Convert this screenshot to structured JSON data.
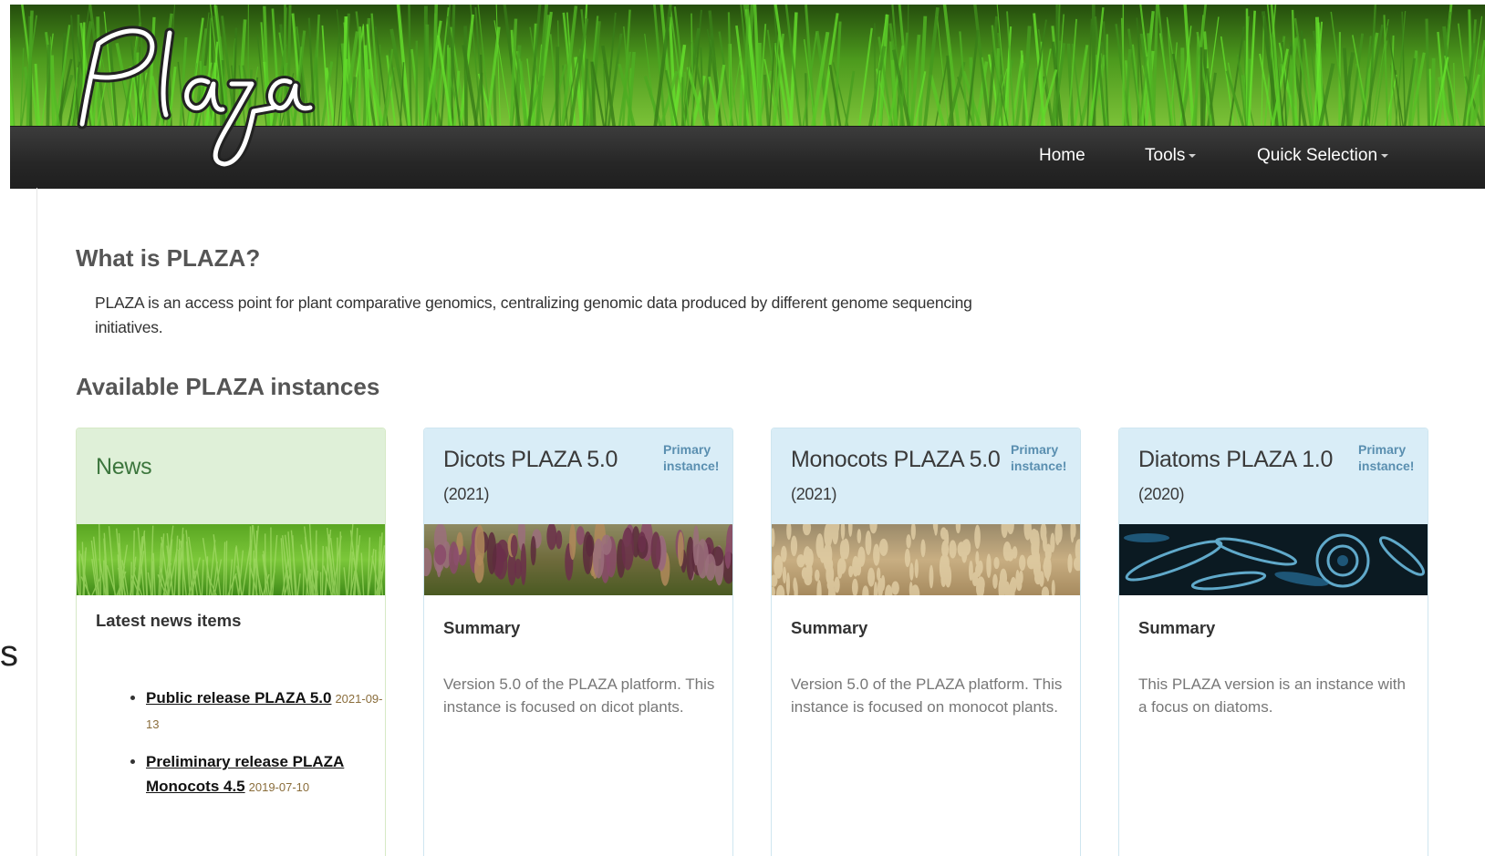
{
  "logo_text": "Plaza",
  "nav": {
    "home": "Home",
    "tools": "Tools",
    "quick_selection": "Quick Selection"
  },
  "stray_char": "s",
  "intro": {
    "heading": "What is PLAZA?",
    "text": "PLAZA is an access point for plant comparative genomics, centralizing genomic data produced by different genome sequencing initiatives."
  },
  "instances": {
    "heading": "Available PLAZA instances"
  },
  "news_card": {
    "title": "News",
    "subheading": "Latest news items",
    "items": [
      {
        "title": "Public release PLAZA 5.0",
        "date": "2021-09-13"
      },
      {
        "title": "Preliminary release PLAZA Monocots 4.5",
        "date": "2019-07-10"
      }
    ]
  },
  "cards": [
    {
      "title": "Dicots PLAZA 5.0",
      "year": "(2021)",
      "tag": "Primary instance!",
      "subheading": "Summary",
      "text": "Version 5.0 of the PLAZA platform. This instance is focused on dicot plants."
    },
    {
      "title": "Monocots PLAZA 5.0",
      "year": "(2021)",
      "tag": "Primary instance!",
      "subheading": "Summary",
      "text": "Version 5.0 of the PLAZA platform. This instance is focused on monocot plants."
    },
    {
      "title": "Diatoms PLAZA 1.0",
      "year": "(2020)",
      "tag": "Primary instance!",
      "subheading": "Summary",
      "text": "This PLAZA version is an instance with a focus on diatoms."
    }
  ],
  "colors": {
    "navbar": "#262626",
    "news_header": "#dff0d8",
    "news_title": "#3c763d",
    "card_header": "#d9edf7",
    "primary_tag": "#5a8fb0",
    "news_date": "#8a6d3b"
  },
  "icons": [
    "tools-caret-icon",
    "quick-selection-caret-icon"
  ]
}
